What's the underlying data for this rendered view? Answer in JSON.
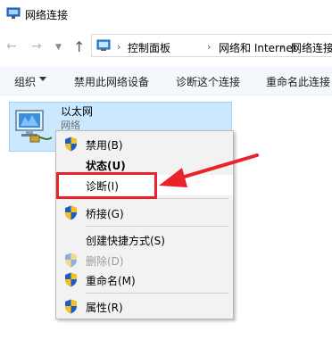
{
  "window": {
    "title": "网络连接",
    "icon": "network-connections-icon"
  },
  "address_bar": {
    "breadcrumbs": [
      "控制面板",
      "网络和 Internet",
      "网络连接"
    ]
  },
  "toolbar": {
    "organize": "组织",
    "disable_device": "禁用此网络设备",
    "diagnose": "诊断这个连接",
    "rename": "重命名此连接"
  },
  "adapter": {
    "name": "以太网",
    "status": "网络",
    "icon": "ethernet-adapter-icon"
  },
  "context_menu": {
    "items": [
      {
        "label": "禁用(B)",
        "shield": true,
        "bold": false,
        "disabled": false
      },
      {
        "label": "状态(U)",
        "shield": false,
        "bold": true,
        "disabled": false
      },
      {
        "label": "诊断(I)",
        "shield": false,
        "bold": false,
        "disabled": false,
        "highlighted": true
      },
      {
        "label": "桥接(G)",
        "shield": true,
        "bold": false,
        "disabled": false
      },
      {
        "label": "创建快捷方式(S)",
        "shield": false,
        "bold": false,
        "disabled": false
      },
      {
        "label": "删除(D)",
        "shield": true,
        "bold": false,
        "disabled": true
      },
      {
        "label": "重命名(M)",
        "shield": true,
        "bold": false,
        "disabled": false
      },
      {
        "label": "属性(R)",
        "shield": true,
        "bold": false,
        "disabled": false
      }
    ]
  },
  "colors": {
    "annotation": "#e8232a",
    "selection": "#cce8ff",
    "menu_bg": "#f2f2f2"
  }
}
